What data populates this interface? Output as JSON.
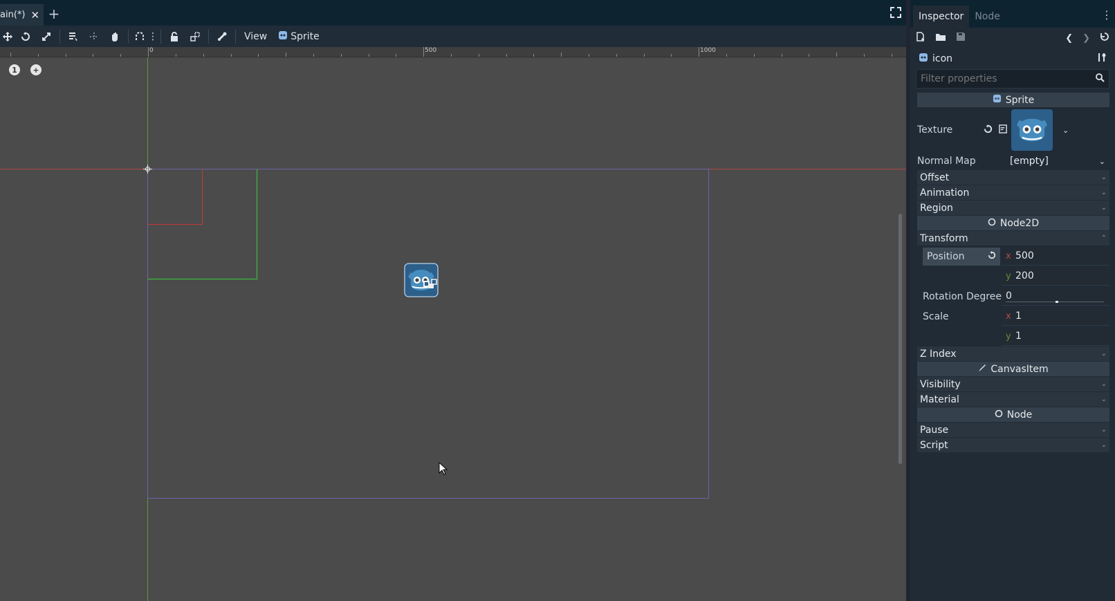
{
  "scene_tabs": [
    {
      "label": "ain(*)"
    }
  ],
  "toolbar": {
    "view_label": "View",
    "sprite_label": "Sprite"
  },
  "ruler": {
    "labels": [
      "0",
      "500",
      "1000"
    ]
  },
  "inspector": {
    "tabs": [
      {
        "label": "Inspector"
      },
      {
        "label": "Node"
      }
    ],
    "node_name": "icon",
    "filter_placeholder": "Filter properties",
    "sections": {
      "sprite": "Sprite",
      "node2d": "Node2D",
      "canvas_item": "CanvasItem",
      "node": "Node"
    },
    "texture_label": "Texture",
    "normal_map_label": "Normal Map",
    "normal_map_value": "[empty]",
    "groups": {
      "offset": "Offset",
      "animation": "Animation",
      "region": "Region",
      "transform": "Transform",
      "z_index": "Z Index",
      "visibility": "Visibility",
      "material": "Material",
      "pause": "Pause",
      "script": "Script"
    },
    "position_label": "Position",
    "position_x": "500",
    "position_y": "200",
    "rotation_label": "Rotation Degree",
    "rotation_value": "0",
    "scale_label": "Scale",
    "scale_x": "1",
    "scale_y": "1",
    "axis_x": "x",
    "axis_y": "y"
  },
  "colors": {
    "accent": "#6aa9e4",
    "x_axis": "#d04848",
    "y_axis": "#48b048",
    "viewport_bg": "#4b4b4b",
    "frame_outline": "#7a6ab8"
  }
}
